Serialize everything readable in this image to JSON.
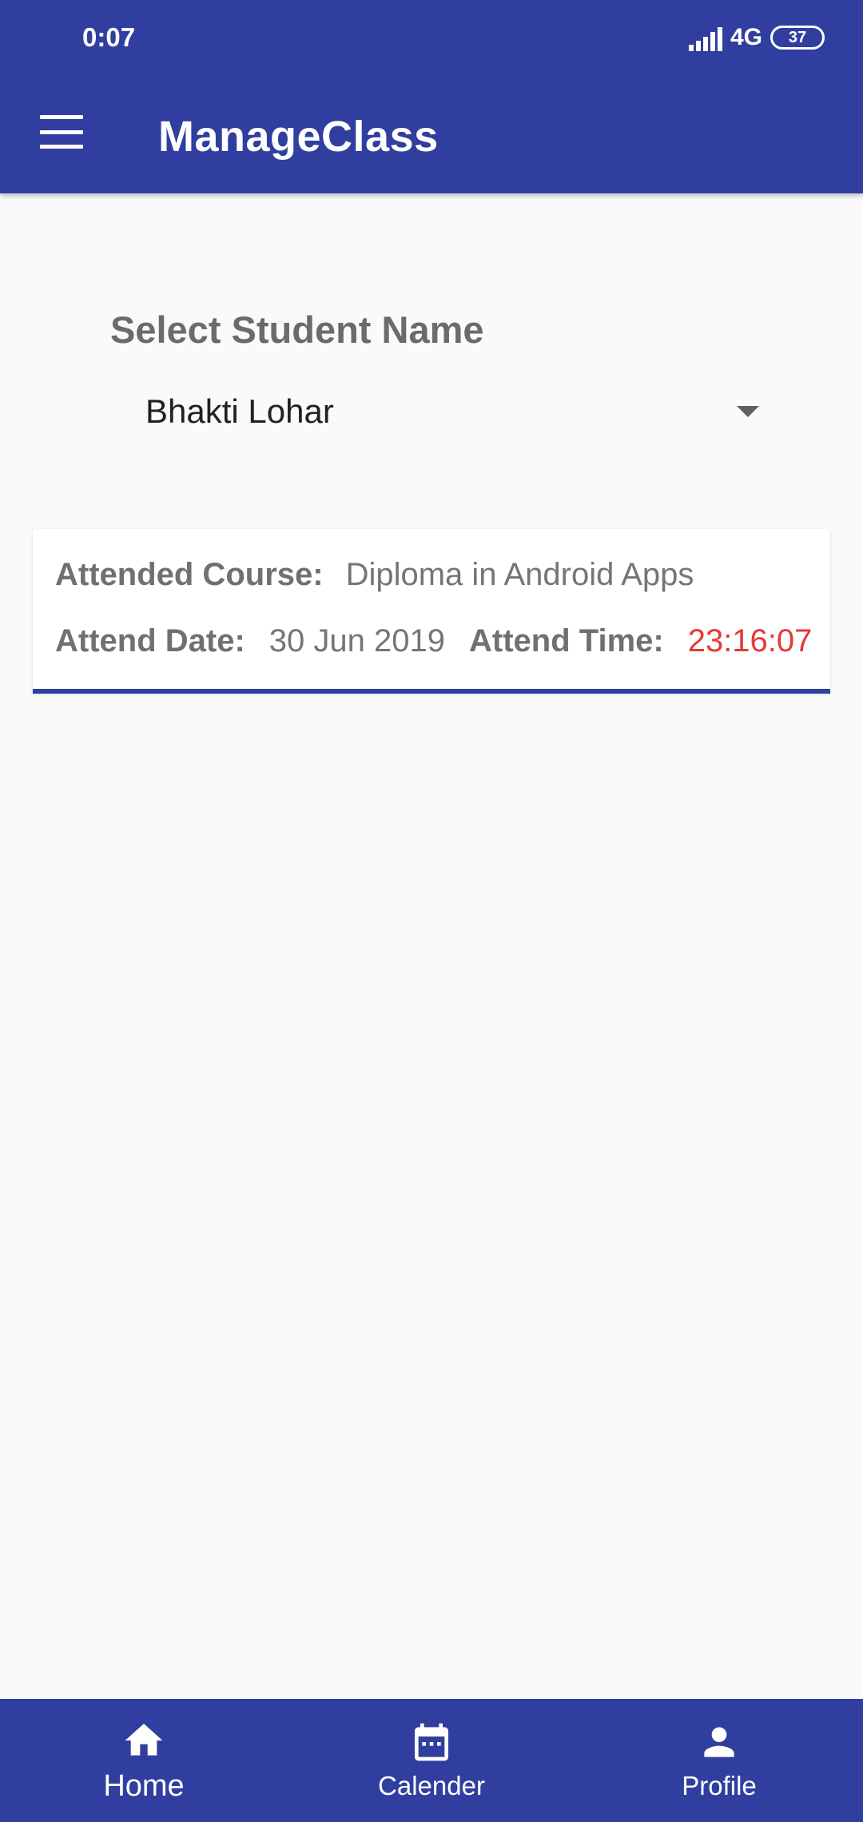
{
  "status_bar": {
    "time": "0:07",
    "network": "4G",
    "battery": "37"
  },
  "app_bar": {
    "title": "ManageClass",
    "menu_icon": "hamburger-menu-icon"
  },
  "student_selector": {
    "label": "Select Student Name",
    "selected": "Bhakti Lohar"
  },
  "attendance_record": {
    "course_label": "Attended Course:",
    "course_value": "Diploma in Android Apps",
    "date_label": "Attend Date:",
    "date_value": "30 Jun 2019",
    "time_label": "Attend Time:",
    "time_value": "23:16:07"
  },
  "bottom_nav": {
    "items": [
      {
        "label": "Home",
        "icon": "home-icon",
        "active": true
      },
      {
        "label": "Calender",
        "icon": "calendar-icon",
        "active": false
      },
      {
        "label": "Profile",
        "icon": "person-icon",
        "active": false
      }
    ]
  },
  "colors": {
    "primary": "#303f9f",
    "background": "#fafafa",
    "time_accent": "#e53935"
  }
}
